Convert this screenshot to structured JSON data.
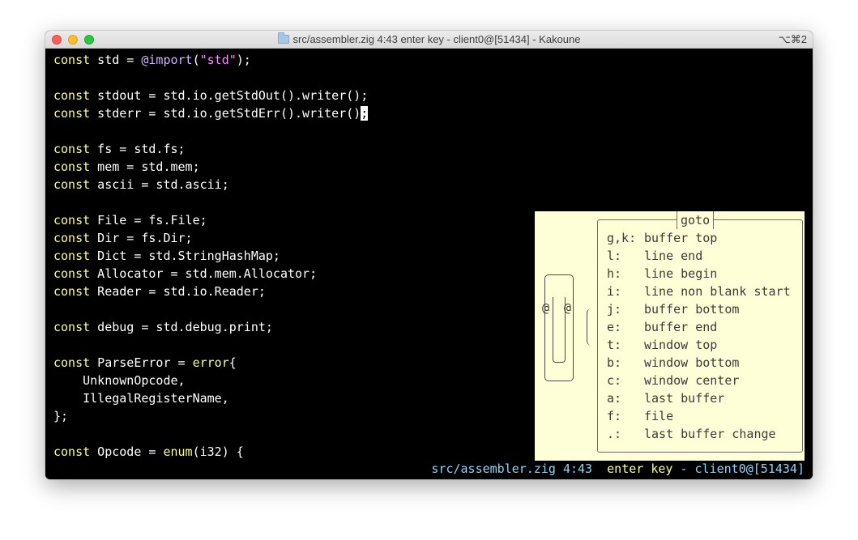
{
  "window": {
    "title": "src/assembler.zig 4:43  enter key - client0@[51434] - Kakoune",
    "shortcut": "⌥⌘2"
  },
  "code_lines": [
    [
      {
        "t": "const",
        "c": "kw"
      },
      {
        "t": " std = "
      },
      {
        "t": "@import",
        "c": "bi"
      },
      {
        "t": "("
      },
      {
        "t": "\"std\"",
        "c": "str"
      },
      {
        "t": ");"
      }
    ],
    [],
    [
      {
        "t": "const",
        "c": "kw"
      },
      {
        "t": " stdout = std.io.getStdOut().writer();"
      }
    ],
    [
      {
        "t": "const",
        "c": "kw"
      },
      {
        "t": " stderr = std.io.getStdErr().writer()"
      },
      {
        "t": ";",
        "c": "cursor"
      }
    ],
    [],
    [
      {
        "t": "const",
        "c": "kw"
      },
      {
        "t": " fs = std.fs;"
      }
    ],
    [
      {
        "t": "const",
        "c": "kw"
      },
      {
        "t": " mem = std.mem;"
      }
    ],
    [
      {
        "t": "const",
        "c": "kw"
      },
      {
        "t": " ascii = std.ascii;"
      }
    ],
    [],
    [
      {
        "t": "const",
        "c": "kw"
      },
      {
        "t": " File = fs.File;"
      }
    ],
    [
      {
        "t": "const",
        "c": "kw"
      },
      {
        "t": " Dir = fs.Dir;"
      }
    ],
    [
      {
        "t": "const",
        "c": "kw"
      },
      {
        "t": " Dict = std.StringHashMap;"
      }
    ],
    [
      {
        "t": "const",
        "c": "kw"
      },
      {
        "t": " Allocator = std.mem.Allocator;"
      }
    ],
    [
      {
        "t": "const",
        "c": "kw"
      },
      {
        "t": " Reader = std.io.Reader;"
      }
    ],
    [],
    [
      {
        "t": "const",
        "c": "kw"
      },
      {
        "t": " debug = std.debug.print;"
      }
    ],
    [],
    [
      {
        "t": "const",
        "c": "kw"
      },
      {
        "t": " ParseError = "
      },
      {
        "t": "error",
        "c": "kw"
      },
      {
        "t": "{"
      }
    ],
    [
      {
        "t": "    UnknownOpcode,"
      }
    ],
    [
      {
        "t": "    IllegalRegisterName,"
      }
    ],
    [
      {
        "t": "};"
      }
    ],
    [],
    [
      {
        "t": "const",
        "c": "kw"
      },
      {
        "t": " Opcode = "
      },
      {
        "t": "enum",
        "c": "kw"
      },
      {
        "t": "(i32) {"
      }
    ]
  ],
  "status": {
    "file": "src/assembler.zig 4:43",
    "mode": "enter key",
    "client": "client0@[51434]"
  },
  "goto_menu": {
    "title": "goto",
    "clippy_eyes": "@",
    "items": [
      {
        "key": "g,k:",
        "label": "buffer top"
      },
      {
        "key": "l:",
        "label": "line end"
      },
      {
        "key": "h:",
        "label": "line begin"
      },
      {
        "key": "i:",
        "label": "line non blank start"
      },
      {
        "key": "j:",
        "label": "buffer bottom"
      },
      {
        "key": "e:",
        "label": "buffer end"
      },
      {
        "key": "t:",
        "label": "window top"
      },
      {
        "key": "b:",
        "label": "window bottom"
      },
      {
        "key": "c:",
        "label": "window center"
      },
      {
        "key": "a:",
        "label": "last buffer"
      },
      {
        "key": "f:",
        "label": "file"
      },
      {
        "key": ".:",
        "label": "last buffer change"
      }
    ]
  },
  "colors": {
    "keyword": "#ffff87",
    "string": "#ff87ff",
    "builtin": "#d7afff",
    "status_blue": "#87d7ff",
    "info_bg": "#ffffd7"
  }
}
